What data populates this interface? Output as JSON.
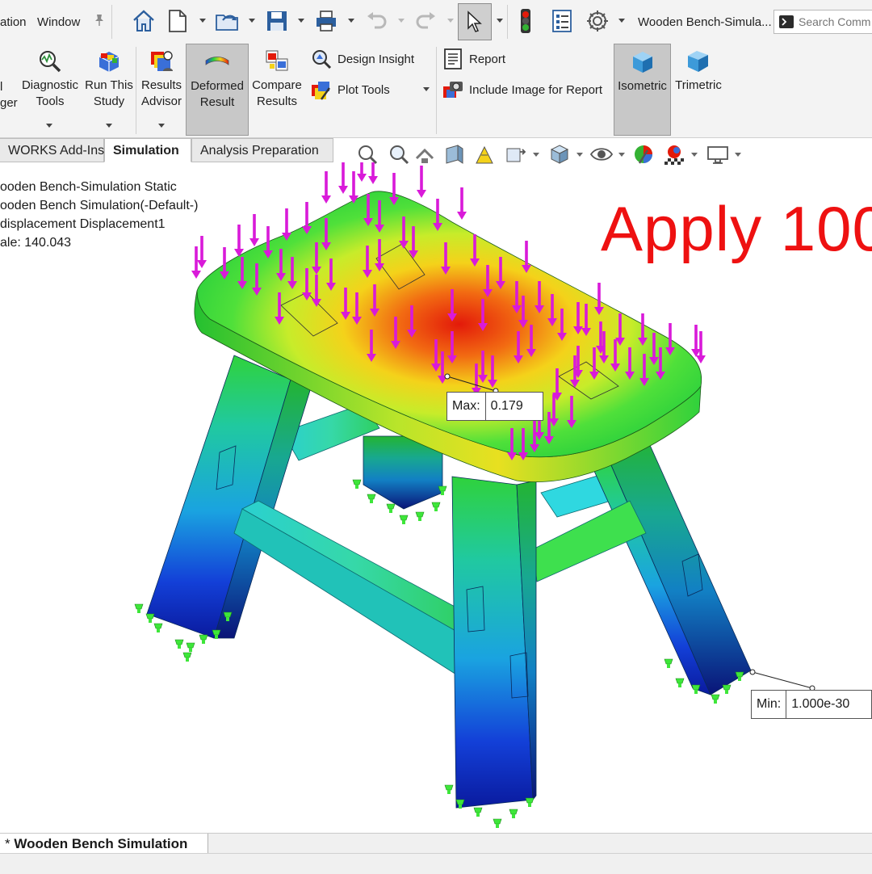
{
  "menu": {
    "items": [
      "ation",
      "Window"
    ],
    "pin_icon": "pin-icon"
  },
  "quick_access": {
    "icons": [
      "home-icon",
      "new-document-icon",
      "open-folder-icon",
      "save-icon",
      "print-icon",
      "undo-icon",
      "redo-icon",
      "select-pointer-icon",
      "traffic-light-icon",
      "file-properties-icon",
      "options-gear-icon"
    ]
  },
  "document": {
    "title": "Wooden Bench-Simula..."
  },
  "search": {
    "placeholder": "Search Comm",
    "icon": "command-prompt-icon"
  },
  "ribbon": {
    "cut_label_1": "l",
    "cut_label_2": "ger",
    "diagnostic_tools": {
      "line1": "Diagnostic",
      "line2": "Tools"
    },
    "run_this_study": {
      "line1": "Run This",
      "line2": "Study"
    },
    "results_advisor": {
      "line1": "Results",
      "line2": "Advisor"
    },
    "deformed_result": {
      "line1": "Deformed",
      "line2": "Result"
    },
    "compare_results": {
      "line1": "Compare",
      "line2": "Results"
    },
    "design_insight": "Design Insight",
    "plot_tools": "Plot Tools",
    "report": "Report",
    "include_image": "Include Image for Report",
    "isometric": "Isometric",
    "trimetric": "Trimetric"
  },
  "tabs": [
    {
      "label": "WORKS Add-Ins",
      "active": false
    },
    {
      "label": "Simulation",
      "active": true
    },
    {
      "label": "Analysis Preparation",
      "active": false
    }
  ],
  "plot_info": {
    "line1": "ooden Bench-Simulation Static",
    "line2": "ooden Bench Simulation(-Default-)",
    "line3": " displacement Displacement1",
    "line4": "ale: 140.043"
  },
  "overlay": {
    "text": "Apply 100",
    "color": "#ee1111"
  },
  "probes": {
    "max_key": "Max:",
    "max_value": "0.179",
    "min_key": "Min:",
    "min_value": "1.000e-30"
  },
  "colors": {
    "max_displacement": "#e31a0a",
    "min_displacement": "#0a1a9e",
    "load_arrow": "#d91ad9",
    "fixture": "#3ee63a"
  },
  "bottom": {
    "model_tab": "Wooden Bench Simulation",
    "model_tab_prefix": "*"
  }
}
